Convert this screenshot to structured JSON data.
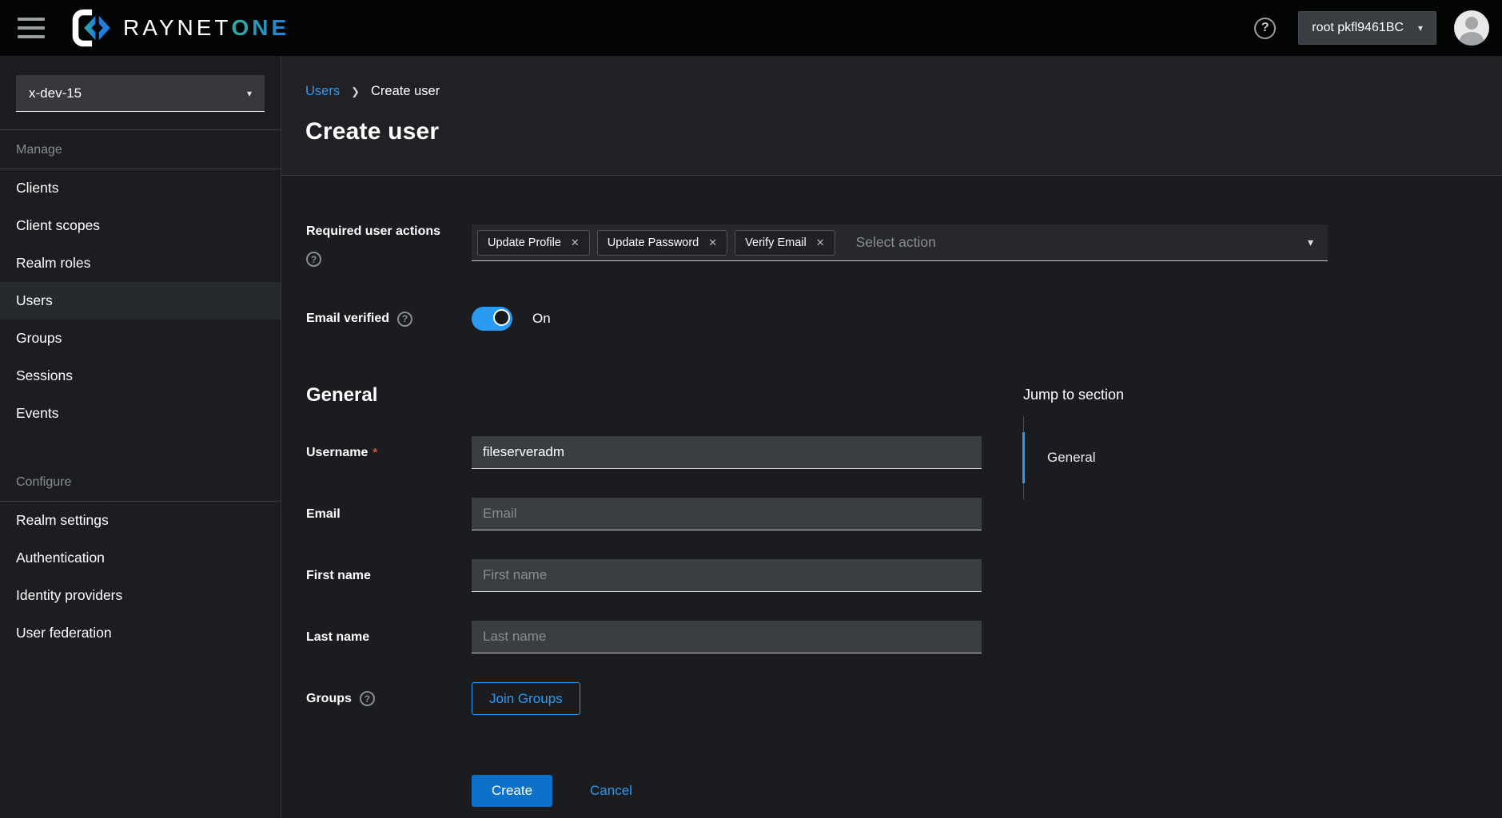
{
  "masthead": {
    "brand_primary": "RAYNET",
    "brand_secondary": "ONE",
    "help_icon": "?",
    "user_menu_label": "root pkfl9461BC"
  },
  "icons": {
    "caret_down": "▾",
    "chip_close": "✕",
    "breadcrumb_sep": "❯",
    "help": "?"
  },
  "sidebar": {
    "realm_selector": "x-dev-15",
    "sections": [
      {
        "label": "Manage",
        "items": [
          {
            "label": "Clients",
            "active": false
          },
          {
            "label": "Client scopes",
            "active": false
          },
          {
            "label": "Realm roles",
            "active": false
          },
          {
            "label": "Users",
            "active": true
          },
          {
            "label": "Groups",
            "active": false
          },
          {
            "label": "Sessions",
            "active": false
          },
          {
            "label": "Events",
            "active": false
          }
        ]
      },
      {
        "label": "Configure",
        "items": [
          {
            "label": "Realm settings",
            "active": false
          },
          {
            "label": "Authentication",
            "active": false
          },
          {
            "label": "Identity providers",
            "active": false
          },
          {
            "label": "User federation",
            "active": false
          }
        ]
      }
    ]
  },
  "breadcrumb": {
    "parent": "Users",
    "current": "Create user"
  },
  "page": {
    "title": "Create user"
  },
  "form": {
    "required_actions": {
      "label": "Required user actions",
      "chips": [
        "Update Profile",
        "Update Password",
        "Verify Email"
      ],
      "placeholder": "Select action"
    },
    "email_verified": {
      "label": "Email verified",
      "state": "On"
    },
    "general_heading": "General",
    "required_marker": "*",
    "fields": [
      {
        "label": "Username",
        "value": "fileserveradm",
        "placeholder": ""
      },
      {
        "label": "Email",
        "value": "",
        "placeholder": "Email"
      },
      {
        "label": "First name",
        "value": "",
        "placeholder": "First name"
      },
      {
        "label": "Last name",
        "value": "",
        "placeholder": "Last name"
      }
    ],
    "groups": {
      "label": "Groups",
      "button_label": "Join Groups"
    },
    "actions": {
      "create_label": "Create",
      "cancel_label": "Cancel"
    }
  },
  "jump_to_section": {
    "title": "Jump to section",
    "items": [
      {
        "label": "General",
        "active": true
      }
    ]
  },
  "colors": {
    "accent_blue": "#2b9af3",
    "primary_button": "#0d70c9",
    "toggle_on": "#2b9af3",
    "required_marker": "#d2534c",
    "brand_gradient_start": "#2fae9d",
    "brand_gradient_end": "#1f7fdd"
  }
}
